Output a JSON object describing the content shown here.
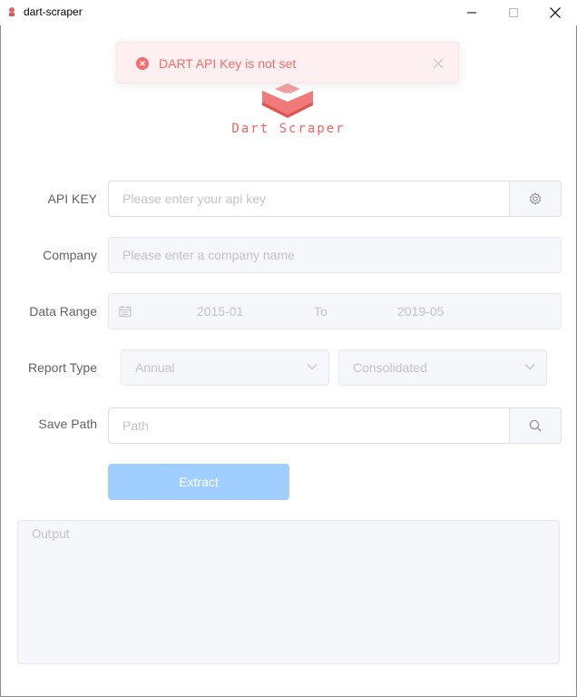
{
  "window": {
    "title": "dart-scraper"
  },
  "alert": {
    "message": "DART API Key is not set",
    "color": "#f56c6c"
  },
  "logo": {
    "text": "Dart Scraper",
    "color": "#f06464"
  },
  "form": {
    "api_key": {
      "label": "API KEY",
      "placeholder": "Please enter your api key",
      "append_icon": "gear-icon"
    },
    "company": {
      "label": "Company",
      "placeholder": "Please enter a company name"
    },
    "date_range": {
      "label": "Data Range",
      "start": "2015-01",
      "separator": "To",
      "end": "2019-05",
      "icon": "calendar-icon"
    },
    "report_type": {
      "label": "Report Type",
      "period": "Annual",
      "scope": "Consolidated"
    },
    "save_path": {
      "label": "Save Path",
      "placeholder": "Path",
      "append_icon": "search-icon"
    },
    "extract_label": "Extract",
    "accent": "#a0cfff"
  },
  "output": {
    "placeholder": "Output"
  }
}
